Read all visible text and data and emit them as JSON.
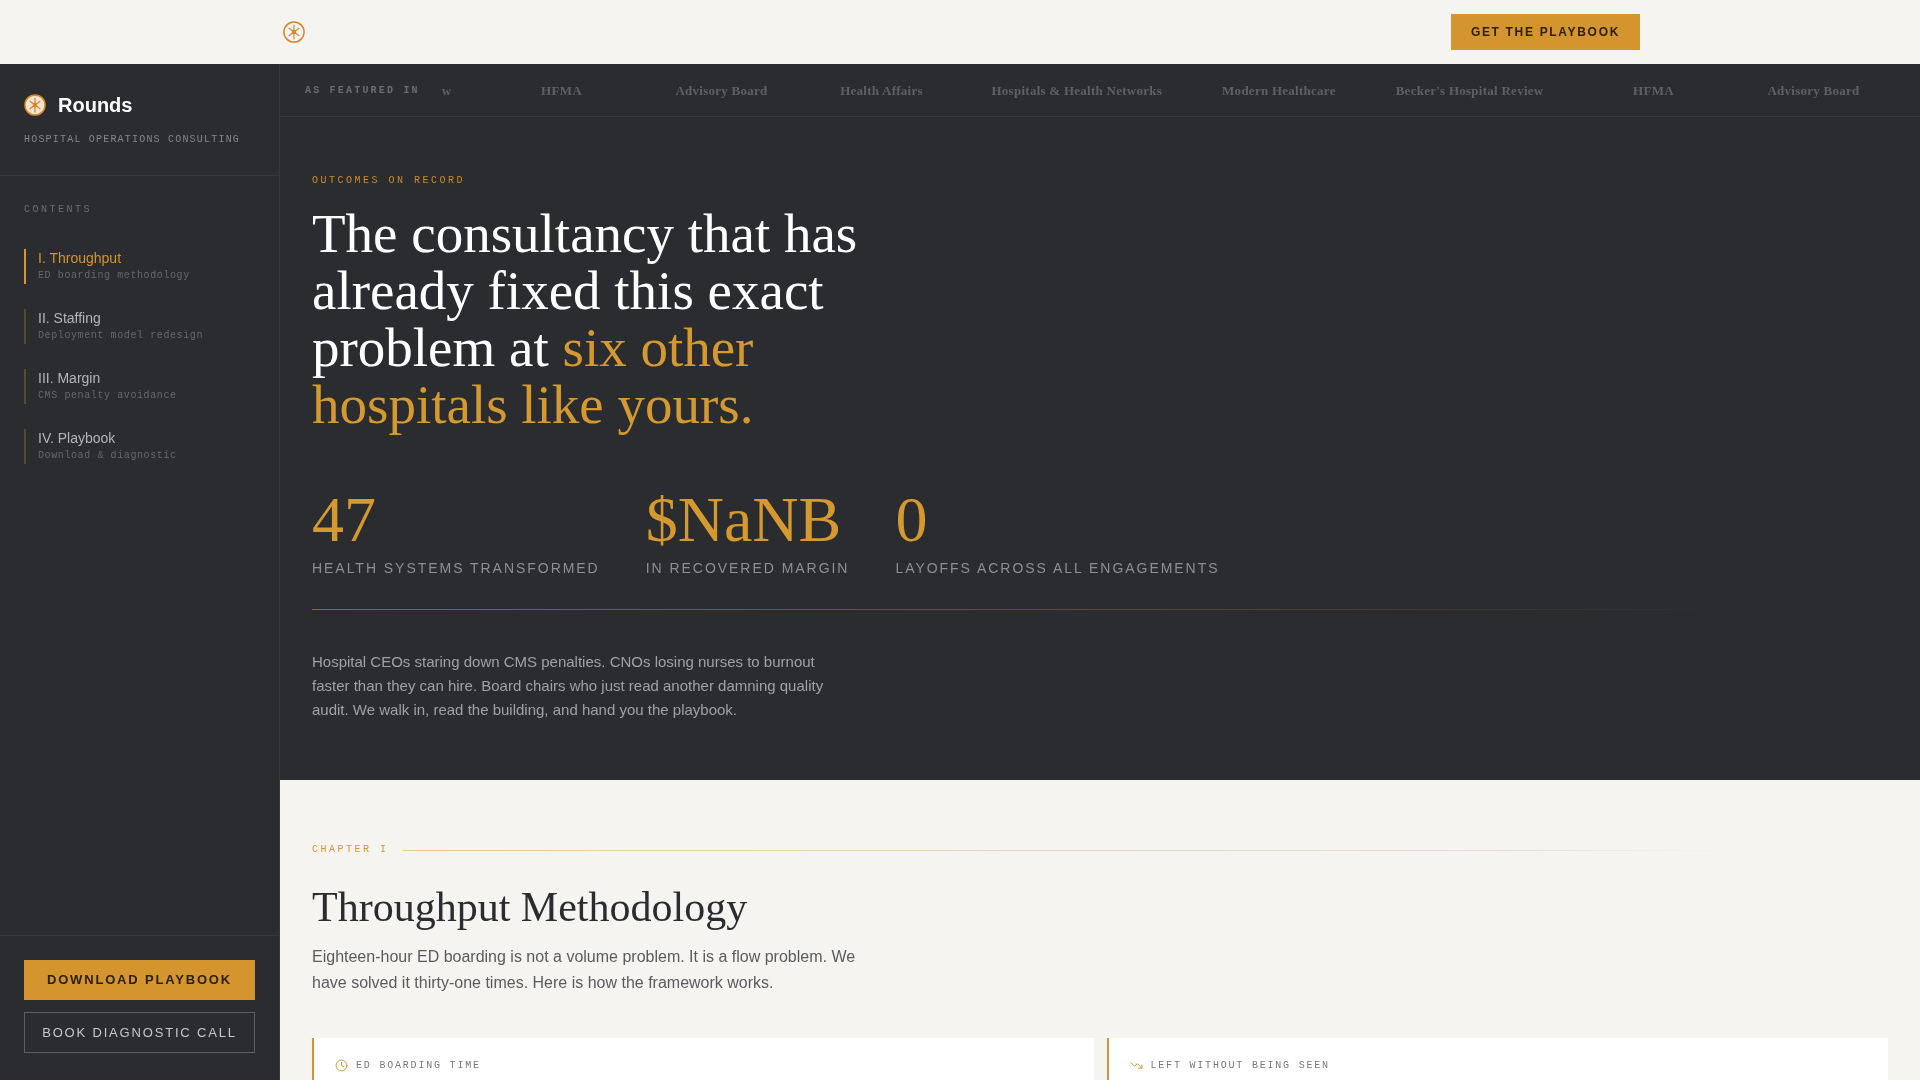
{
  "top_bar": {
    "cta": "GET THE PLAYBOOK"
  },
  "sidebar": {
    "brand": "Rounds",
    "tagline": "HOSPITAL OPERATIONS CONSULTING",
    "contents_label": "CONTENTS",
    "items": [
      {
        "title": "I. Throughput",
        "subtitle": "ED boarding methodology",
        "selected": true
      },
      {
        "title": "II. Staffing",
        "subtitle": "Deployment model redesign",
        "selected": false
      },
      {
        "title": "III. Margin",
        "subtitle": "CMS penalty avoidance",
        "selected": false
      },
      {
        "title": "IV. Playbook",
        "subtitle": "Download & diagnostic",
        "selected": false
      }
    ],
    "buttons": [
      {
        "label": "DOWNLOAD PLAYBOOK",
        "kind": "primary"
      },
      {
        "label": "BOOK DIAGNOSTIC CALL",
        "kind": "outline"
      }
    ]
  },
  "featured": {
    "label": "AS FEATURED IN",
    "outlets": [
      "w",
      "HFMA",
      "Advisory Board",
      "Health Affairs",
      "Hospitals & Health Networks",
      "Modern Healthcare",
      "Becker's Hospital Review",
      "HFMA",
      "Advisory Board"
    ]
  },
  "hero": {
    "eyebrow": "OUTCOMES ON RECORD",
    "headline": "The consultancy that has already fixed this exact problem at",
    "headline_highlight": "six other hospitals like yours.",
    "stats": [
      {
        "value": "47",
        "label": "HEALTH SYSTEMS TRANSFORMED"
      },
      {
        "value": "$NaNB",
        "label": "IN RECOVERED MARGIN"
      },
      {
        "value": "0",
        "label": "LAYOFFS ACROSS ALL ENGAGEMENTS"
      }
    ],
    "intro": "Hospital CEOs staring down CMS penalties. CNOs losing nurses to burnout faster than they can hire. Board chairs who just read another damning quality audit. We walk in, read the building, and hand you the playbook."
  },
  "chapter": {
    "eyebrow": "CHAPTER I",
    "title": "Throughput Methodology",
    "intro": "Eighteen-hour ED boarding is not a volume problem. It is a flow problem. We have solved it thirty-one times. Here is how the framework works.",
    "cards": [
      {
        "label": "ED BOARDING TIME"
      },
      {
        "label": "LEFT WITHOUT BEING SEEN"
      }
    ]
  }
}
